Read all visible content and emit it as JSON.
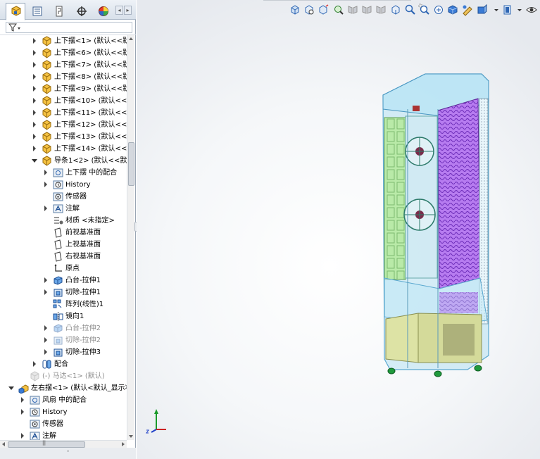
{
  "tree": {
    "rows": [
      {
        "label": "上下摆<1> (默认<<默认>_",
        "kind": "part",
        "depth": 2,
        "expand": "closed"
      },
      {
        "label": "上下摆<6> (默认<<默认>_",
        "kind": "part",
        "depth": 2,
        "expand": "closed"
      },
      {
        "label": "上下摆<7> (默认<<默认>_",
        "kind": "part",
        "depth": 2,
        "expand": "closed"
      },
      {
        "label": "上下摆<8> (默认<<默认>_",
        "kind": "part",
        "depth": 2,
        "expand": "closed"
      },
      {
        "label": "上下摆<9> (默认<<默认>_",
        "kind": "part",
        "depth": 2,
        "expand": "closed"
      },
      {
        "label": "上下摆<10> (默认<<默认>",
        "kind": "part",
        "depth": 2,
        "expand": "closed"
      },
      {
        "label": "上下摆<11> (默认<<默认>",
        "kind": "part",
        "depth": 2,
        "expand": "closed"
      },
      {
        "label": "上下摆<12> (默认<<默认>",
        "kind": "part",
        "depth": 2,
        "expand": "closed"
      },
      {
        "label": "上下摆<13> (默认<<默认>",
        "kind": "part",
        "depth": 2,
        "expand": "closed"
      },
      {
        "label": "上下摆<14> (默认<<默认>",
        "kind": "part",
        "depth": 2,
        "expand": "closed"
      },
      {
        "label": "导条1<2> (默认<<默认>_显",
        "kind": "part",
        "depth": 2,
        "expand": "open"
      },
      {
        "label": "上下摆 中的配合",
        "kind": "mates-folder",
        "depth": 3,
        "expand": "closed"
      },
      {
        "label": "History",
        "kind": "history",
        "depth": 3,
        "expand": "closed"
      },
      {
        "label": "传感器",
        "kind": "sensor",
        "depth": 3,
        "expand": "none"
      },
      {
        "label": "注解",
        "kind": "annotation",
        "depth": 3,
        "expand": "closed"
      },
      {
        "label": "材质 <未指定>",
        "kind": "material",
        "depth": 3,
        "expand": "none"
      },
      {
        "label": "前视基准面",
        "kind": "plane",
        "depth": 3,
        "expand": "none"
      },
      {
        "label": "上视基准面",
        "kind": "plane",
        "depth": 3,
        "expand": "none"
      },
      {
        "label": "右视基准面",
        "kind": "plane",
        "depth": 3,
        "expand": "none"
      },
      {
        "label": "原点",
        "kind": "origin",
        "depth": 3,
        "expand": "none"
      },
      {
        "label": "凸台-拉伸1",
        "kind": "boss",
        "depth": 3,
        "expand": "closed"
      },
      {
        "label": "切除-拉伸1",
        "kind": "cut",
        "depth": 3,
        "expand": "closed"
      },
      {
        "label": "阵列(线性)1",
        "kind": "pattern",
        "depth": 3,
        "expand": "none"
      },
      {
        "label": "镜向1",
        "kind": "mirror",
        "depth": 3,
        "expand": "none"
      },
      {
        "label": "凸台-拉伸2",
        "kind": "boss",
        "depth": 3,
        "expand": "closed",
        "dim": true
      },
      {
        "label": "切除-拉伸2",
        "kind": "cut",
        "depth": 3,
        "expand": "closed",
        "dim": true
      },
      {
        "label": "切除-拉伸3",
        "kind": "cut",
        "depth": 3,
        "expand": "closed"
      },
      {
        "label": "配合",
        "kind": "mates",
        "depth": 2,
        "expand": "closed"
      },
      {
        "label": "(-) 马达<1> (默认)",
        "kind": "part-suppressed",
        "depth": 1,
        "expand": "none",
        "dim": true
      },
      {
        "label": "左右摆<1> (默认<默认_显示状态",
        "kind": "subassembly",
        "depth": 0,
        "expand": "open"
      },
      {
        "label": "风扇 中的配合",
        "kind": "mates-folder",
        "depth": 1,
        "expand": "closed"
      },
      {
        "label": "History",
        "kind": "history",
        "depth": 1,
        "expand": "closed"
      },
      {
        "label": "传感器",
        "kind": "sensor",
        "depth": 1,
        "expand": "none"
      },
      {
        "label": "注解",
        "kind": "annotation",
        "depth": 1,
        "expand": "closed"
      }
    ]
  },
  "icons": {
    "tabs": [
      "feature-manager-icon",
      "property-manager-icon",
      "configuration-manager-icon",
      "dimxpert-icon",
      "display-manager-icon"
    ],
    "filter": "filter-icon",
    "heads_up": [
      "zoom-to-fit-icon",
      "zoom-to-area-icon",
      "previous-view-icon",
      "section-view-icon",
      "dynamic-annotation-icon",
      "view-orientation-icon",
      "display-style-icon",
      "hide-show-icon",
      "edit-appearance-icon",
      "apply-scene-icon",
      "view-settings-icon"
    ]
  },
  "colors": {
    "accent": "#2f66b3",
    "model_glass": "#9fd7ee",
    "model_coil": "#9a54e0",
    "model_green": "#a7e59a",
    "model_base": "#d7dca0"
  }
}
